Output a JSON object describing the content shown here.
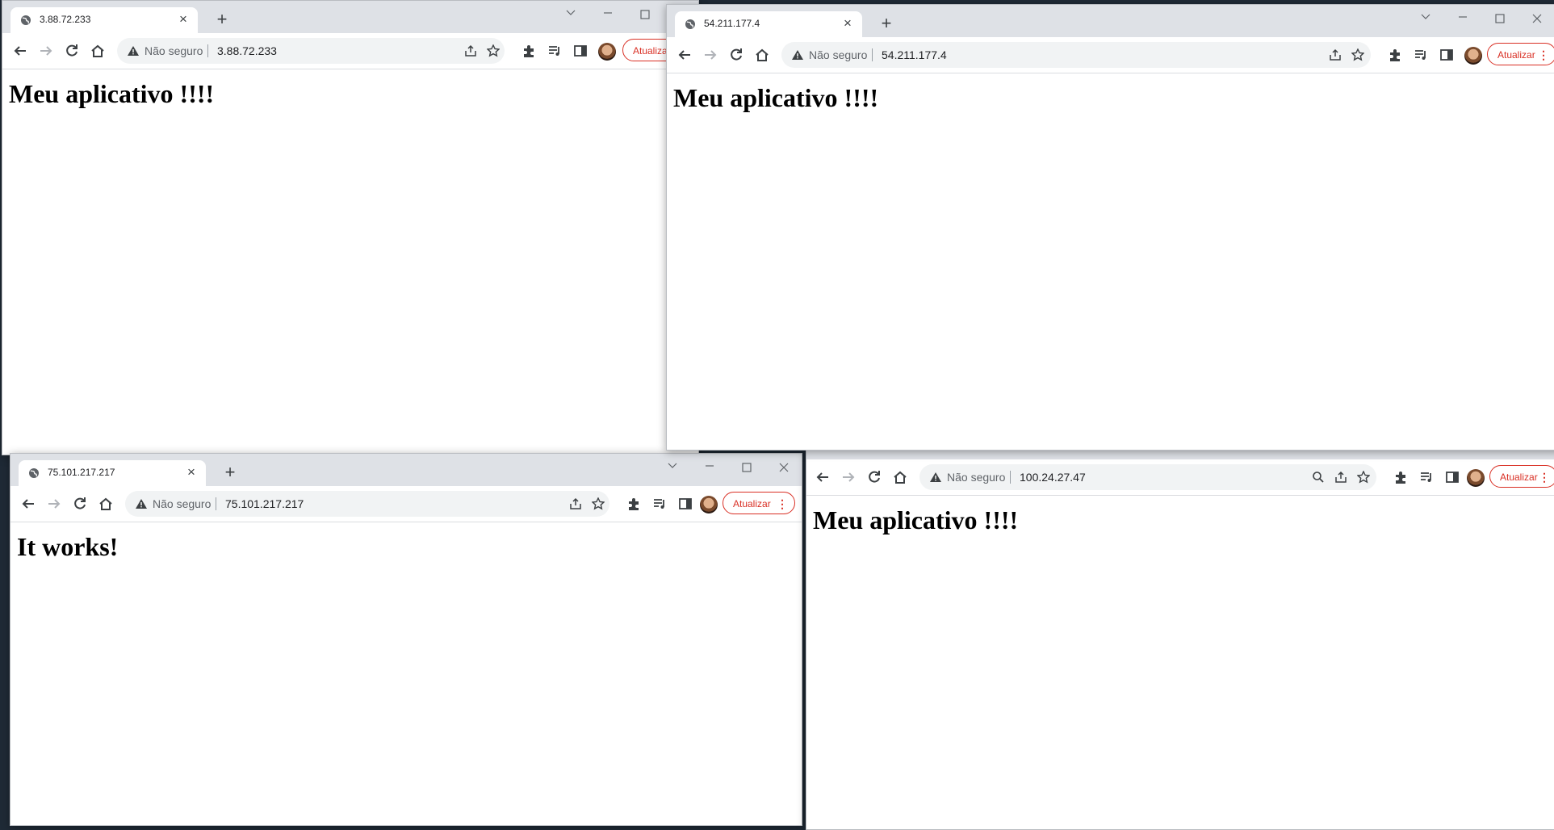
{
  "windows": [
    {
      "tab_title": "3.88.72.233",
      "security_label": "Não seguro",
      "url": "3.88.72.233",
      "update_label": "Atualizar",
      "page_heading": "Meu aplicativo !!!!"
    },
    {
      "tab_title": "54.211.177.4",
      "security_label": "Não seguro",
      "url": "54.211.177.4",
      "update_label": "Atualizar",
      "page_heading": "Meu aplicativo !!!!"
    },
    {
      "tab_title": "75.101.217.217",
      "security_label": "Não seguro",
      "url": "75.101.217.217",
      "update_label": "Atualizar",
      "page_heading": "It works!"
    },
    {
      "security_label": "Não seguro",
      "url": "100.24.27.47",
      "update_label": "Atualizar",
      "page_heading": "Meu aplicativo !!!!"
    }
  ],
  "colors": {
    "tabstrip": "#dee1e6",
    "omnibox": "#f1f3f4",
    "update_accent": "#d93025",
    "desktop": "#1f2a36"
  },
  "icons": [
    "globe-icon",
    "close-icon",
    "plus-icon",
    "minimize-icon",
    "maximize-icon",
    "chevron-down-icon",
    "back-arrow-icon",
    "forward-arrow-icon",
    "reload-icon",
    "home-icon",
    "warning-icon",
    "share-icon",
    "star-icon",
    "search-icon",
    "extensions-icon",
    "media-icon",
    "side-panel-icon",
    "kebab-menu-icon"
  ]
}
